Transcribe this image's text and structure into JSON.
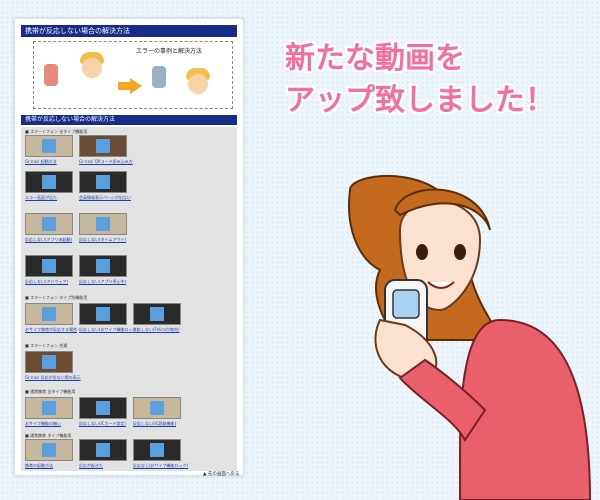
{
  "page": {
    "title": "携帯が反応しない場合の解決方法",
    "illustration_caption": "エラーの事例と解決方法",
    "section_title": "携帯が反応しない場合の解決方法",
    "back_to_top": "▲ 先の画面へ戻る"
  },
  "groups": [
    {
      "title": "■ スマートフォン  全タイプ機能用",
      "items": [
        {
          "label": "Gr-navi 起動方法"
        },
        {
          "label": "Gr-navi QRコード読み込み方"
        },
        {
          "label": "エラー画面が出た"
        },
        {
          "label": "会員情報表示ページが出ない"
        },
        {
          "label": "反応しない(アプリ未起動)"
        },
        {
          "label": "反応しない(タイムアウト)"
        },
        {
          "label": "反応しない(アドウェア)"
        },
        {
          "label": "反応しない(アプリ停止中)"
        }
      ]
    },
    {
      "title": "■ スマートフォン  タイプ別機能用",
      "items": [
        {
          "label": "おサイフ携帯が反応する場合"
        },
        {
          "label": "反応しない(おサイフ機能ロック)"
        },
        {
          "label": "反応しない(Felicaが無効)"
        }
      ]
    },
    {
      "title": "■ スマートフォン  共通",
      "items": [
        {
          "label": "Gr-navi 反応が出ない際の表示"
        }
      ]
    },
    {
      "title": "■ 通常携帯  全タイプ機能用",
      "items": [
        {
          "label": "おサイフ機能の無い"
        },
        {
          "label": "反応しない(ICカード設定)"
        },
        {
          "label": "反応しない(IC読取機能)"
        }
      ]
    },
    {
      "title": "■ 通常携帯  タイプ機能用",
      "items": [
        {
          "label": "携帯の起動方法"
        },
        {
          "label": "反応が起きた"
        },
        {
          "label": "反応なし(おサイフ機能ロック)"
        }
      ]
    }
  ],
  "headline": {
    "line1": "新たな動画を",
    "line2": "アップ致しました！"
  },
  "colors": {
    "accent": "#f46ea0",
    "banner": "#172b8a"
  }
}
